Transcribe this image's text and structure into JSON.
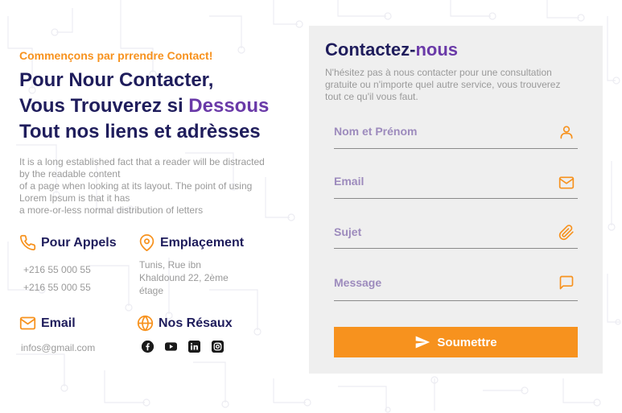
{
  "intro": {
    "kicker": "Commençons par prrendre Contact!",
    "headline_line1": "Pour Nour Contacter,",
    "headline_line2a": "Vous Trouverez si ",
    "headline_line2b": "Dessous",
    "headline_line3": "Tout nos liens et adrèsses",
    "desc_line1": "It is a long established fact that a reader will be distracted",
    "desc_line2": "by the readable content",
    "desc_line3": "of a page when looking at its layout. The point of using",
    "desc_line4": "Lorem Ipsum is that it has",
    "desc_line5": "a more-or-less normal distribution of letters"
  },
  "info": {
    "calls": {
      "title": "Pour Appels",
      "phone1": "+216 55 000 55",
      "phone2": "+216 55 000 55",
      "icon": "phone-icon"
    },
    "location": {
      "title": "Emplaçement",
      "line1": "Tunis, Rue ibn",
      "line2": "Khaldound 22, 2ème",
      "line3": "étage",
      "icon": "map-pin-icon"
    },
    "email": {
      "title": "Email",
      "address": "infos@gmail.com",
      "icon": "mail-icon"
    },
    "networks": {
      "title": "Nos Résaux",
      "icon": "globe-icon",
      "items": [
        "facebook-icon",
        "youtube-icon",
        "linkedin-icon",
        "instagram-icon"
      ]
    }
  },
  "form": {
    "title_a": "Contactez-",
    "title_b": "nous",
    "desc_line1": "N'hésitez pas à nous contacter pour une consultation",
    "desc_line2": "gratuite ou n'importe quel autre service, vous trouverez",
    "desc_line3": "tout ce qu'il vous faut.",
    "name_label": "Nom et Prénom",
    "email_label": "Email",
    "subject_label": "Sujet",
    "message_label": "Message",
    "submit_label": "Soumettre"
  },
  "colors": {
    "accent": "#f7921e",
    "navy": "#1f1d5c",
    "purple": "#6a3aa8"
  }
}
